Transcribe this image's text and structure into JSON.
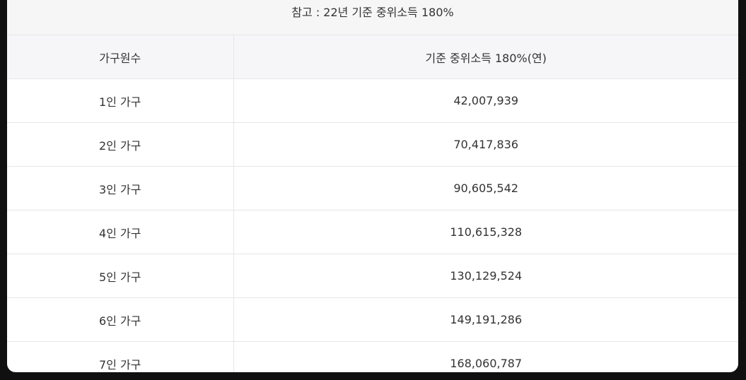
{
  "caption": "참고 : 22년 기준 중위소득 180%",
  "table": {
    "headers": [
      "가구원수",
      "기준 중위소득 180%(연)"
    ],
    "rows": [
      [
        "1인 가구",
        "42,007,939"
      ],
      [
        "2인 가구",
        "70,417,836"
      ],
      [
        "3인 가구",
        "90,605,542"
      ],
      [
        "4인 가구",
        "110,615,328"
      ],
      [
        "5인 가구",
        "130,129,524"
      ],
      [
        "6인 가구",
        "149,191,286"
      ],
      [
        "7인 가구",
        "168,060,787"
      ]
    ]
  }
}
